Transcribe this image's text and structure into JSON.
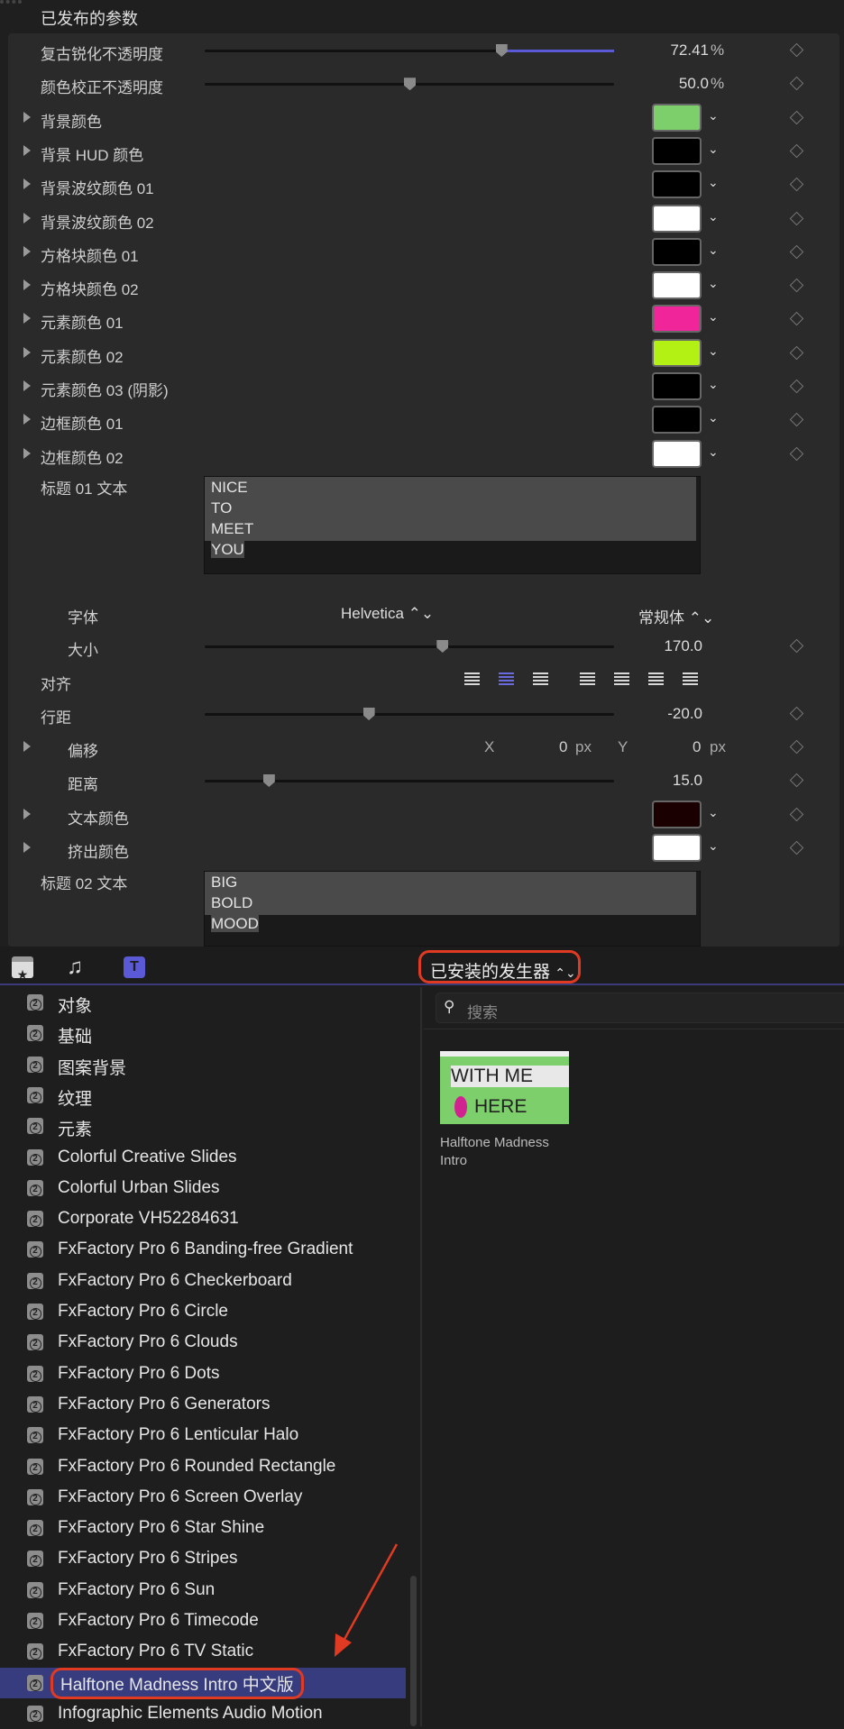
{
  "inspector": {
    "title": "已发布的参数",
    "sliders": [
      {
        "label": "复古锐化不透明度",
        "value": "72.41",
        "unit": "%",
        "position": 0.7241,
        "filled": true
      },
      {
        "label": "颜色校正不透明度",
        "value": "50.0",
        "unit": "%",
        "position": 0.5,
        "filled": false
      }
    ],
    "colors": [
      {
        "label": "背景颜色",
        "color": "#7ccf6a"
      },
      {
        "label": "背景 HUD 颜色",
        "color": "#000000"
      },
      {
        "label": "背景波纹颜色 01",
        "color": "#000000"
      },
      {
        "label": "背景波纹颜色 02",
        "color": "#ffffff"
      },
      {
        "label": "方格块颜色 01",
        "color": "#000000"
      },
      {
        "label": "方格块颜色 02",
        "color": "#ffffff"
      },
      {
        "label": "元素颜色 01",
        "color": "#f0259a"
      },
      {
        "label": "元素颜色 02",
        "color": "#b3f013"
      },
      {
        "label": "元素颜色 03 (阴影)",
        "color": "#000000"
      },
      {
        "label": "边框颜色 01",
        "color": "#000000"
      },
      {
        "label": "边框颜色 02",
        "color": "#ffffff"
      }
    ],
    "title1": {
      "label": "标题 01 文本",
      "lines": [
        "NICE",
        "TO",
        "MEET",
        "YOU"
      ]
    },
    "font": {
      "label": "字体",
      "family": "Helvetica",
      "style": "常规体"
    },
    "size": {
      "label": "大小",
      "value": "170.0",
      "position": 0.58
    },
    "align": {
      "label": "对齐",
      "selected": 1
    },
    "leading": {
      "label": "行距",
      "value": "-20.0",
      "position": 0.4
    },
    "offset": {
      "label": "偏移",
      "x_label": "X",
      "x": "0",
      "y_label": "Y",
      "y": "0",
      "unit": "px"
    },
    "distance": {
      "label": "距离",
      "value": "15.0",
      "position": 0.156
    },
    "text_color": {
      "label": "文本颜色",
      "color": "#1a0000"
    },
    "extrude_color": {
      "label": "挤出颜色",
      "color": "#ffffff"
    },
    "title2": {
      "label": "标题 02 文本",
      "lines": [
        "BIG",
        "BOLD",
        "MOOD"
      ]
    }
  },
  "browser": {
    "dropdown": "已安装的发生器",
    "search_placeholder": "搜索",
    "items": [
      "对象",
      "基础",
      "图案背景",
      "纹理",
      "元素",
      "Colorful Creative Slides",
      "Colorful Urban Slides",
      "Corporate VH52284631",
      "FxFactory Pro 6 Banding-free Gradient",
      "FxFactory Pro 6 Checkerboard",
      "FxFactory Pro 6 Circle",
      "FxFactory Pro 6 Clouds",
      "FxFactory Pro 6 Dots",
      "FxFactory Pro 6 Generators",
      "FxFactory Pro 6 Lenticular Halo",
      "FxFactory Pro 6 Rounded Rectangle",
      "FxFactory Pro 6 Screen Overlay",
      "FxFactory Pro 6 Star Shine",
      "FxFactory Pro 6 Stripes",
      "FxFactory Pro 6 Sun",
      "FxFactory Pro 6 Timecode",
      "FxFactory Pro 6 TV Static",
      "Halftone Madness Intro 中文版",
      "Infographic Elements Audio Motion"
    ],
    "selected_index": 22,
    "thumb": {
      "caption": "Halftone Madness Intro",
      "text1": "WITH  ME",
      "text2": "HERE"
    },
    "accent": "#373c7e",
    "highlight": "#e03a22"
  }
}
